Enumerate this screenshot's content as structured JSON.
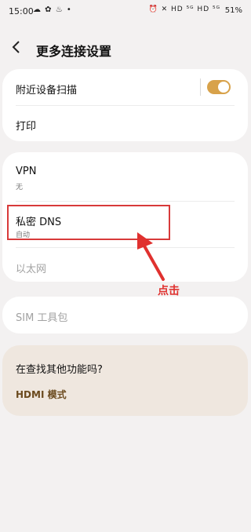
{
  "status_bar": {
    "time": "15:00",
    "left_icons": "☁ ✿ ♨ •",
    "right_icons": "⏰ ✕ HD ⁵ᴳ HD ⁵ᴳ",
    "battery": "51%"
  },
  "header": {
    "title": "更多连接设置"
  },
  "card1": {
    "nearby_scan": {
      "label": "附近设备扫描",
      "toggle_on": true
    },
    "print": {
      "label": "打印"
    }
  },
  "card2": {
    "vpn": {
      "label": "VPN",
      "sub": "无"
    },
    "private_dns": {
      "label": "私密 DNS",
      "sub": "自动"
    },
    "ethernet": {
      "label": "以太网"
    }
  },
  "card3": {
    "sim_toolkit": {
      "label": "SIM 工具包"
    }
  },
  "annotation": {
    "text": "点击"
  },
  "suggest": {
    "question": "在查找其他功能吗?",
    "link": "HDMI 模式"
  },
  "colors": {
    "accent": "#d8a24a",
    "annotation": "#e0312f",
    "link": "#6b4a1e"
  }
}
